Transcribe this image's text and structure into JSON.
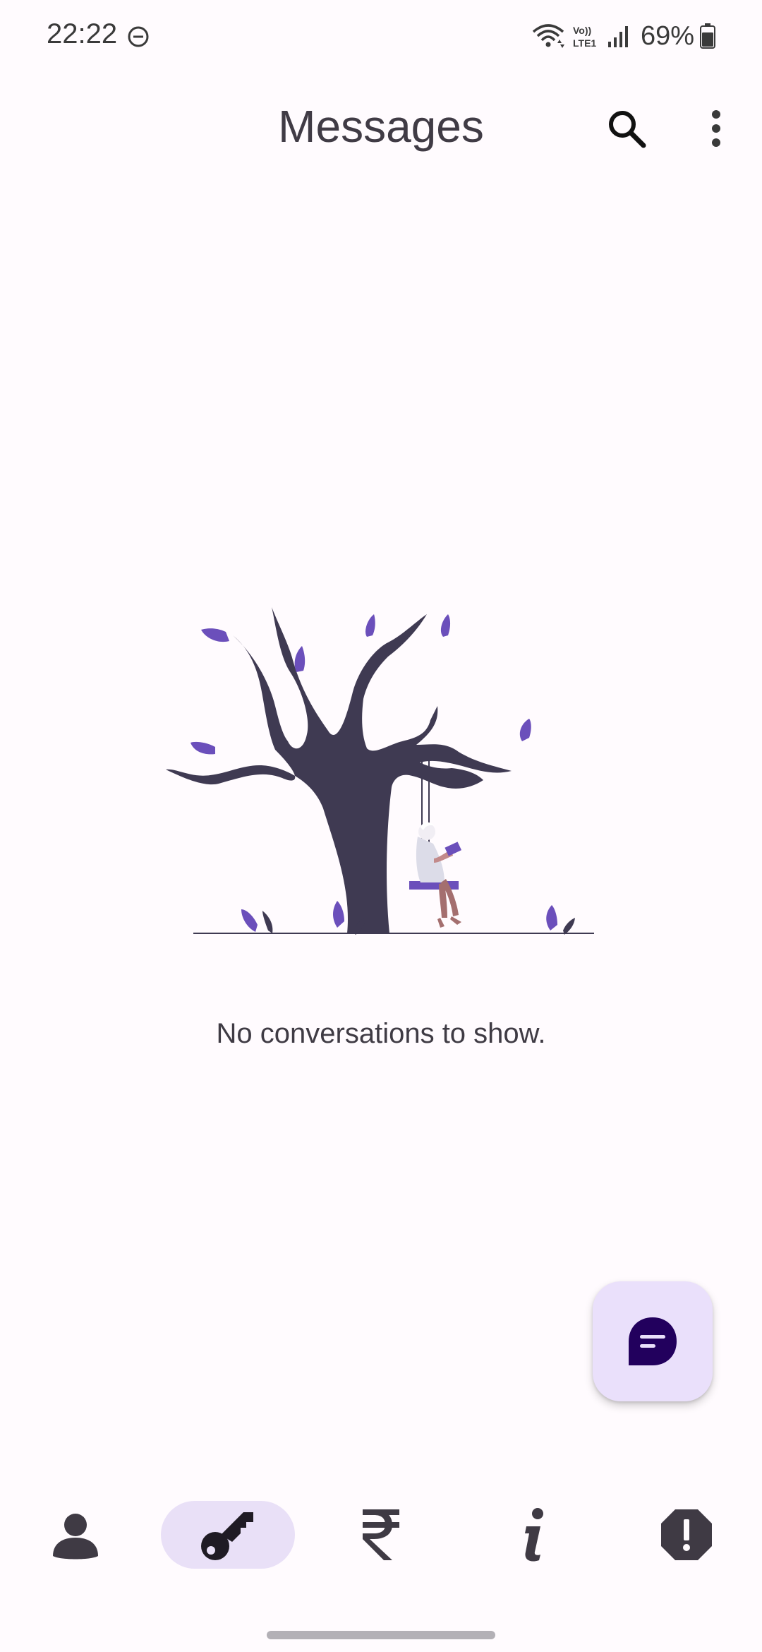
{
  "status_bar": {
    "time": "22:22",
    "battery": "69%",
    "network_label": "Vo)) LTE1"
  },
  "app_bar": {
    "title": "Messages",
    "search_icon": "search-icon",
    "more_icon": "more-vert-icon"
  },
  "empty_state": {
    "message": "No conversations to show."
  },
  "fab": {
    "icon": "chat-bubble-icon"
  },
  "bottom_nav": {
    "items": [
      {
        "icon": "person-icon",
        "active": false
      },
      {
        "icon": "key-icon",
        "active": true
      },
      {
        "icon": "rupee-icon",
        "active": false
      },
      {
        "icon": "info-icon",
        "active": false
      },
      {
        "icon": "alert-octagon-icon",
        "active": false
      }
    ]
  },
  "colors": {
    "background": "#fffbfe",
    "accent": "#6b4fbb",
    "tree": "#3f3a52",
    "fab_bg": "#eae0fb",
    "nav_active_bg": "#e9e0f7",
    "fab_icon": "#22005d"
  }
}
